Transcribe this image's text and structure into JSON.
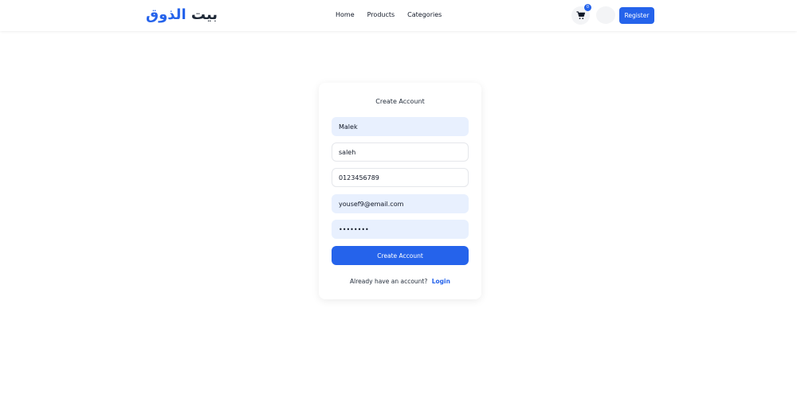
{
  "navbar": {
    "logo_main": "بيت",
    "logo_accent": "الذوق",
    "links": [
      "Home",
      "Products",
      "Categories"
    ],
    "cart_count": "0",
    "register_label": "Register"
  },
  "form": {
    "title": "Create Account",
    "first_name": "Malek",
    "last_name": "saleh",
    "phone": "0123456789",
    "email": "yousef9@email.com",
    "password": "password",
    "submit_label": "Create Account",
    "footer_text": "Already have an account?",
    "login_label": "Login"
  },
  "colors": {
    "accent": "#2563eb",
    "autofill_bg": "#e8f0fe"
  }
}
